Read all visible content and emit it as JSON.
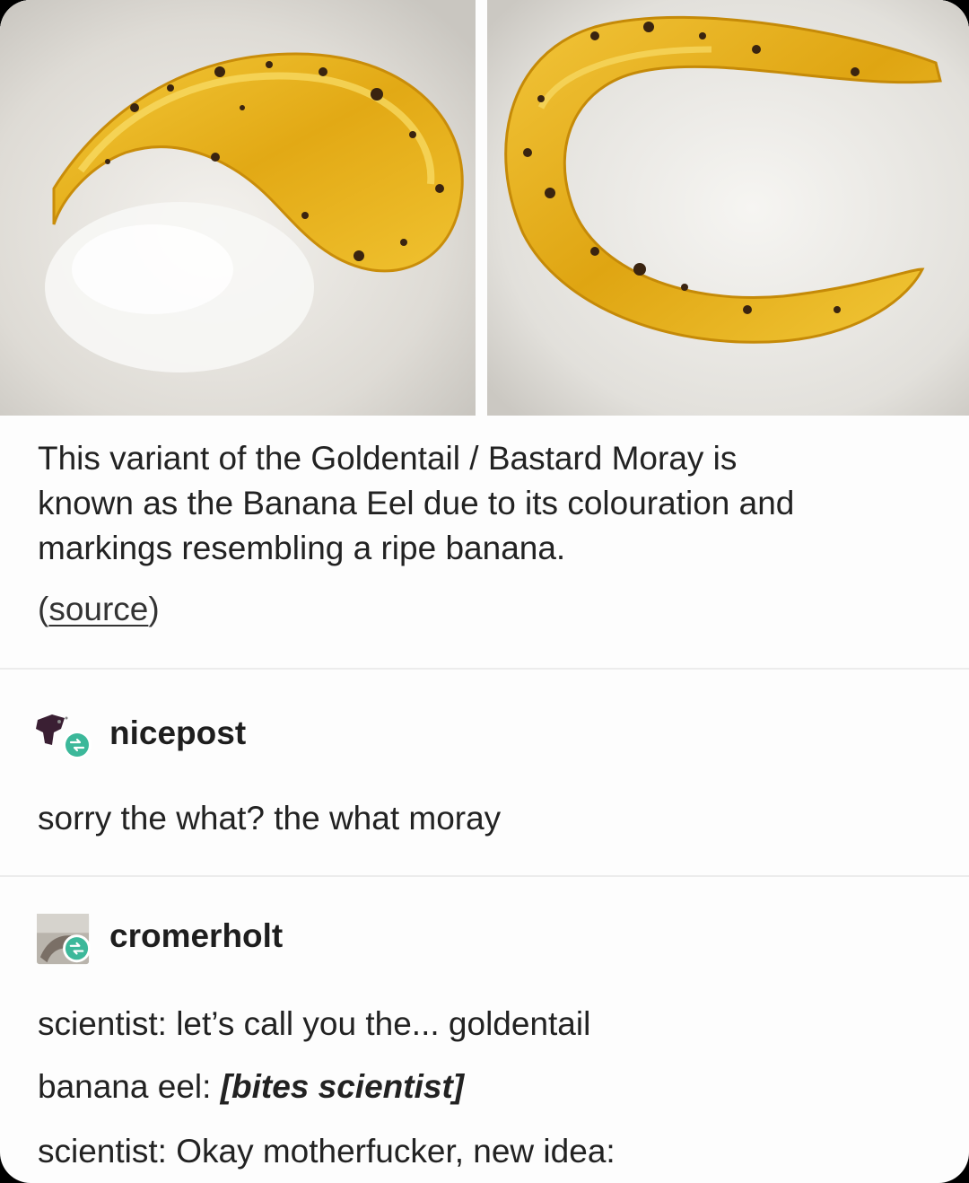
{
  "post": {
    "images": [
      {
        "alt_icon": "yellow-eel-photo-icon"
      },
      {
        "alt_icon": "yellow-eel-photo-icon"
      }
    ],
    "caption_lines": [
      "This variant of the Goldentail / Bastard Moray is",
      "known as the Banana Eel due to its colouration and",
      "markings resembling a ripe banana."
    ],
    "source_open": "(",
    "source_label": "source",
    "source_close": ")"
  },
  "reblogs": [
    {
      "username": "nicepost",
      "avatar_icon": "nicepost-avatar-icon",
      "lines": [
        "sorry the what? the what moray"
      ]
    },
    {
      "username": "cromerholt",
      "avatar_icon": "cromerholt-avatar-icon",
      "line1": "scientist: let’s call you the... goldentail",
      "line2_prefix": "banana eel: ",
      "line2_action": "[bites scientist]",
      "line3": "scientist: Okay motherfucker, new idea:"
    }
  ],
  "colors": {
    "eel_yellow": "#e8b41c",
    "reblog_badge": "#3cb89a",
    "text": "#222222"
  }
}
